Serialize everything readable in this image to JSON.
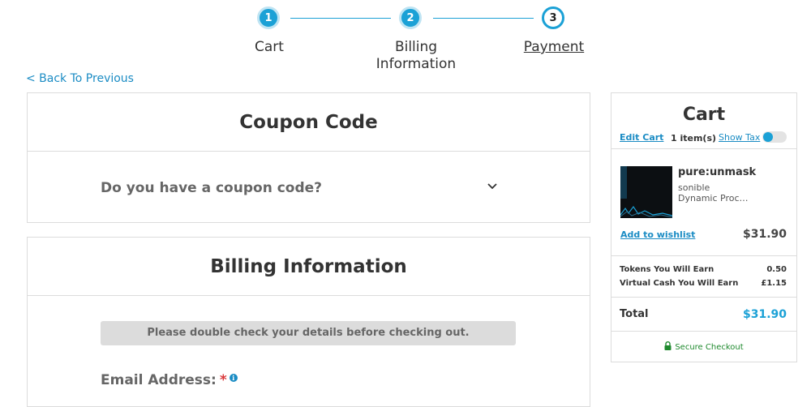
{
  "stepper": {
    "steps": [
      {
        "number": "1",
        "label": "Cart"
      },
      {
        "number": "2",
        "label_line1": "Billing",
        "label_line2": "Information"
      },
      {
        "number": "3",
        "label": "Payment"
      }
    ]
  },
  "back_link": "< Back To Previous",
  "coupon": {
    "title": "Coupon Code",
    "question": "Do you have a coupon code?"
  },
  "billing": {
    "title": "Billing Information",
    "notice": "Please double check your details before checking out.",
    "email_label": "Email Address:",
    "required_mark": "*",
    "info_glyph": "i"
  },
  "cart": {
    "title": "Cart",
    "edit_cart": "Edit Cart",
    "item_count": "1 item(s)",
    "show_tax": "Show Tax",
    "show_tax_on": false,
    "item": {
      "name": "pure:unmask",
      "brand": "sonible",
      "type": "Dynamic Processor",
      "wishlist": "Add to wishlist",
      "price": "$31.90"
    },
    "tokens_label": "Tokens You Will Earn",
    "tokens_value": "0.50",
    "vcash_label": "Virtual Cash You Will Earn",
    "vcash_value": "£1.15",
    "total_label": "Total",
    "total_value": "$31.90",
    "secure_label": "Secure Checkout"
  },
  "colors": {
    "accent": "#1ba1d6",
    "link": "#1b8cc4",
    "secure": "#1f8a2e",
    "required": "#d9383a"
  }
}
